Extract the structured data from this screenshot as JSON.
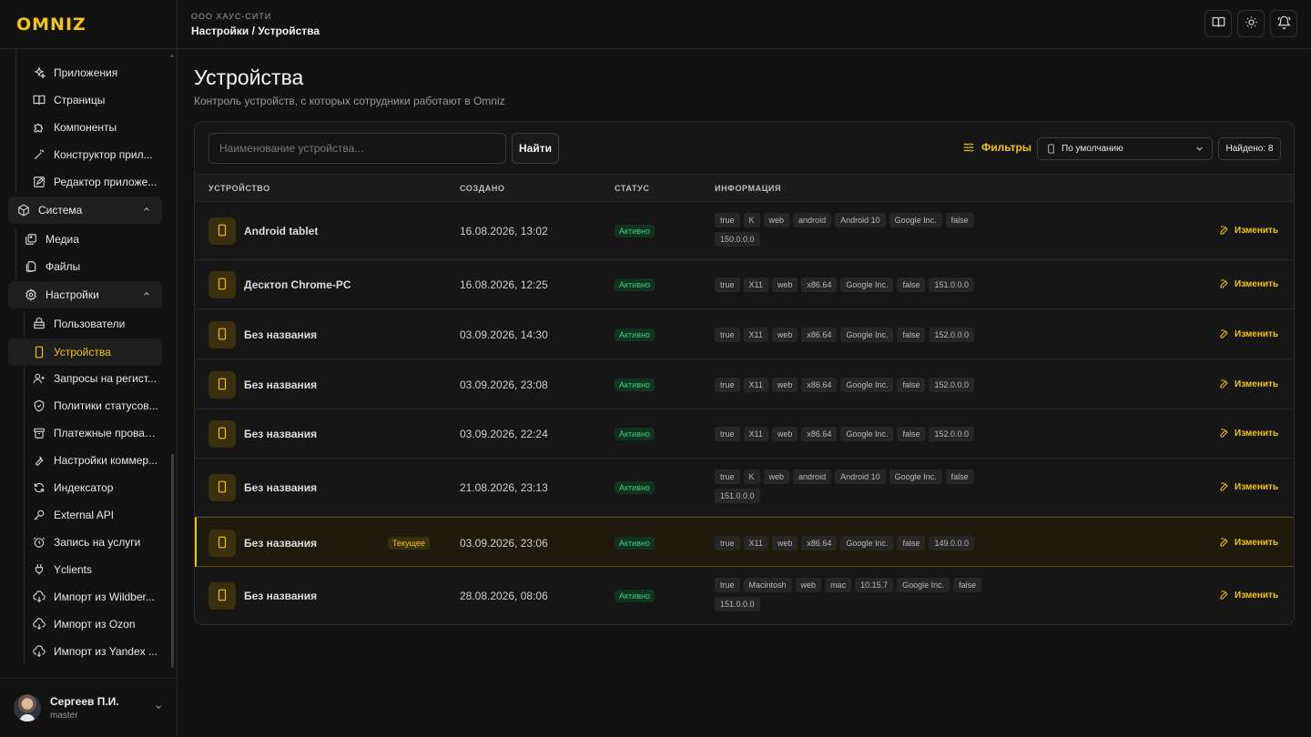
{
  "app": {
    "logo": "OMNIZ"
  },
  "header": {
    "org": "ООО ХАУС-СИТИ",
    "breadcrumb": "Настройки / Устройства",
    "icons": [
      "book-icon",
      "sun-icon",
      "bell-icon"
    ]
  },
  "sidebar": {
    "items": [
      {
        "label": "Приложения",
        "icon": "sparkles-icon"
      },
      {
        "label": "Страницы",
        "icon": "book-open-icon"
      },
      {
        "label": "Компоненты",
        "icon": "puzzle-icon"
      },
      {
        "label": "Конструктор прил...",
        "icon": "wand-icon"
      },
      {
        "label": "Редактор приложе...",
        "icon": "edit-icon"
      }
    ],
    "group_system": {
      "label": "Система",
      "icon": "package-icon"
    },
    "system_items": [
      {
        "label": "Медиа",
        "icon": "image-icon"
      },
      {
        "label": "Файлы",
        "icon": "files-icon"
      }
    ],
    "group_settings": {
      "label": "Настройки",
      "icon": "settings-icon"
    },
    "settings_items": [
      {
        "label": "Пользователи",
        "icon": "users-icon"
      },
      {
        "label": "Устройства",
        "icon": "smartphone-icon",
        "active": true
      },
      {
        "label": "Запросы на регист...",
        "icon": "user-plus-icon"
      },
      {
        "label": "Политики статусов...",
        "icon": "shield-icon"
      },
      {
        "label": "Платежные провай...",
        "icon": "archive-icon"
      },
      {
        "label": "Настройки коммер...",
        "icon": "wrench-icon"
      },
      {
        "label": "Индексатор",
        "icon": "refresh-icon"
      },
      {
        "label": "External API",
        "icon": "key-icon"
      },
      {
        "label": "Запись на услуги",
        "icon": "alarm-icon"
      },
      {
        "label": "Yclients",
        "icon": "plug-icon"
      },
      {
        "label": "Импорт из Wildber...",
        "icon": "cloud-download-icon"
      },
      {
        "label": "Импорт из Ozon",
        "icon": "cloud-download-icon"
      },
      {
        "label": "Импорт из Yandex ...",
        "icon": "cloud-download-icon"
      }
    ]
  },
  "user": {
    "name": "Сергеев П.И.",
    "role": "master"
  },
  "page": {
    "title": "Устройства",
    "subtitle": "Контроль устройств, с которых сотрудники работают в Omniz"
  },
  "toolbar": {
    "search_placeholder": "Наименование устройства...",
    "find_label": "Найти",
    "filters_label": "Фильтры",
    "sort_value": "По умолчанию",
    "found_label": "Найдено: 8"
  },
  "table": {
    "columns": [
      "УСТРОЙСТВО",
      "СОЗДАНО",
      "СТАТУС",
      "ИНФОРМАЦИЯ"
    ],
    "edit_label": "Изменить",
    "current_label": "Текущее",
    "rows": [
      {
        "name": "Android tablet",
        "created": "16.08.2026, 13:02",
        "status": "Активно",
        "current": false,
        "info": [
          "true",
          "K",
          "web",
          "android",
          "Android 10",
          "Google Inc.",
          "false",
          "150.0.0.0"
        ]
      },
      {
        "name": "Десктоп Chrome-PC",
        "created": "16.08.2026, 12:25",
        "status": "Активно",
        "current": false,
        "info": [
          "true",
          "X11",
          "web",
          "x86.64",
          "Google Inc.",
          "false",
          "151.0.0.0"
        ]
      },
      {
        "name": "Без названия",
        "created": "03.09.2026, 14:30",
        "status": "Активно",
        "current": false,
        "info": [
          "true",
          "X11",
          "web",
          "x86.64",
          "Google Inc.",
          "false",
          "152.0.0.0"
        ]
      },
      {
        "name": "Без названия",
        "created": "03.09.2026, 23:08",
        "status": "Активно",
        "current": false,
        "info": [
          "true",
          "X11",
          "web",
          "x86.64",
          "Google Inc.",
          "false",
          "152.0.0.0"
        ]
      },
      {
        "name": "Без названия",
        "created": "03.09.2026, 22:24",
        "status": "Активно",
        "current": false,
        "info": [
          "true",
          "X11",
          "web",
          "x86.64",
          "Google Inc.",
          "false",
          "152.0.0.0"
        ]
      },
      {
        "name": "Без названия",
        "created": "21.08.2026, 23:13",
        "status": "Активно",
        "current": false,
        "info": [
          "true",
          "K",
          "web",
          "android",
          "Android 10",
          "Google Inc.",
          "false",
          "151.0.0.0"
        ]
      },
      {
        "name": "Без названия",
        "created": "03.09.2026, 23:06",
        "status": "Активно",
        "current": true,
        "info": [
          "true",
          "X11",
          "web",
          "x86.64",
          "Google Inc.",
          "false",
          "149.0.0.0"
        ]
      },
      {
        "name": "Без названия",
        "created": "28.08.2026, 08:06",
        "status": "Активно",
        "current": false,
        "info": [
          "true",
          "Macintosh",
          "web",
          "mac",
          "10.15.7",
          "Google Inc.",
          "false",
          "151.0.0.0"
        ]
      }
    ]
  },
  "colors": {
    "accent": "#f0c419",
    "status_green": "#3ecf7a",
    "background": "#121212"
  }
}
